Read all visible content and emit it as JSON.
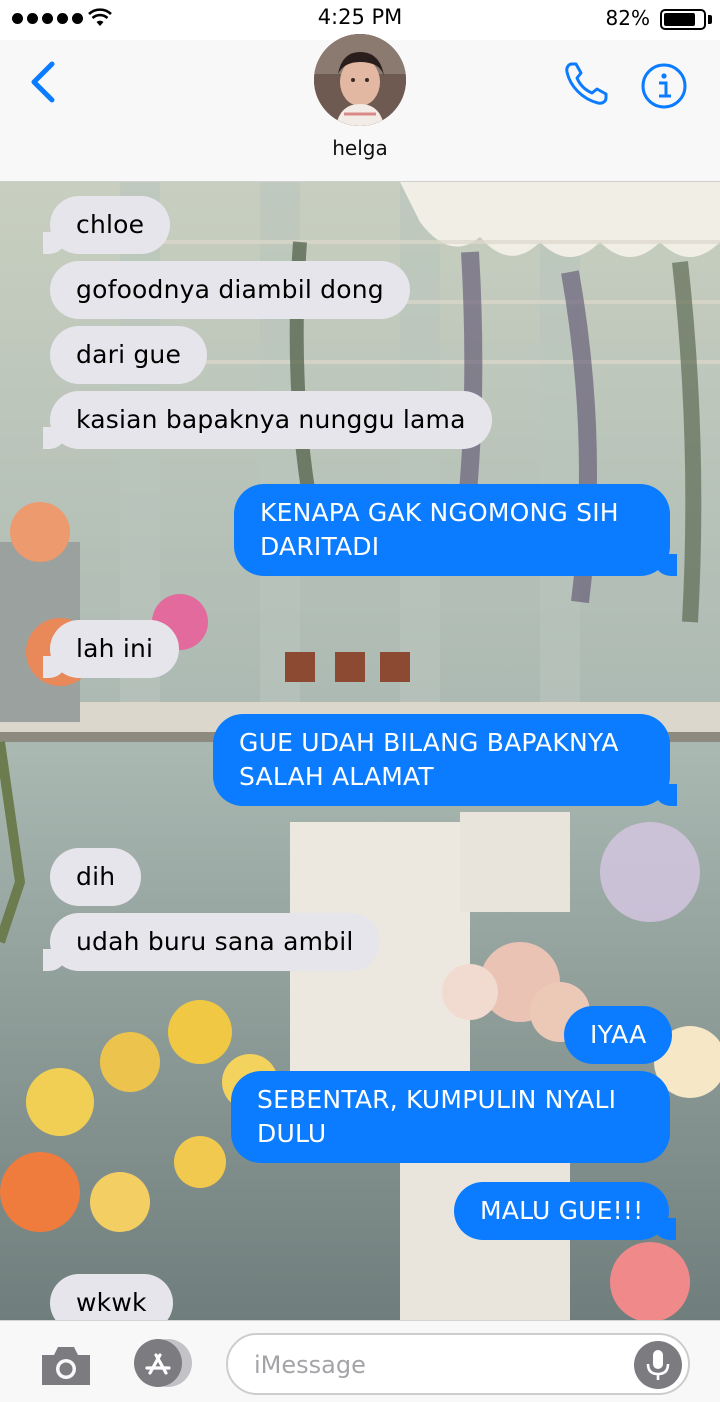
{
  "status_bar": {
    "time": "4:25 PM",
    "battery_percent": "82%",
    "battery_level": 0.82,
    "icons": [
      "signal-dots-icon",
      "wifi-icon",
      "battery-icon"
    ]
  },
  "header": {
    "contact_name": "helga",
    "icons": [
      "back-chevron-icon",
      "phone-icon",
      "info-icon"
    ]
  },
  "messages": [
    {
      "direction": "incoming",
      "text": "chloe"
    },
    {
      "direction": "incoming",
      "text": "gofoodnya diambil dong"
    },
    {
      "direction": "incoming",
      "text": "dari gue"
    },
    {
      "direction": "incoming",
      "text": "kasian bapaknya nunggu lama"
    },
    {
      "direction": "outgoing",
      "line1": "KENAPA GAK NGOMONG SIH",
      "line2": "DARITADI"
    },
    {
      "direction": "incoming",
      "text": "lah ini"
    },
    {
      "direction": "outgoing",
      "line1": "GUE UDAH BILANG BAPAKNYA",
      "line2": "SALAH ALAMAT"
    },
    {
      "direction": "incoming",
      "text": "dih"
    },
    {
      "direction": "incoming",
      "text": "udah buru sana ambil"
    },
    {
      "direction": "outgoing",
      "text": "IYAA"
    },
    {
      "direction": "outgoing",
      "line1": "SEBENTAR, KUMPULIN NYALI",
      "line2": "DULU"
    },
    {
      "direction": "outgoing",
      "text": "MALU GUE!!!"
    },
    {
      "direction": "incoming",
      "text": "wkwk"
    }
  ],
  "input_bar": {
    "placeholder": "iMessage",
    "icons": [
      "camera-icon",
      "app-store-icon",
      "microphone-icon"
    ]
  },
  "colors": {
    "accent": "#0b7cff",
    "incoming_bubble": "#e6e5eb",
    "outgoing_bubble": "#0b7cff"
  }
}
